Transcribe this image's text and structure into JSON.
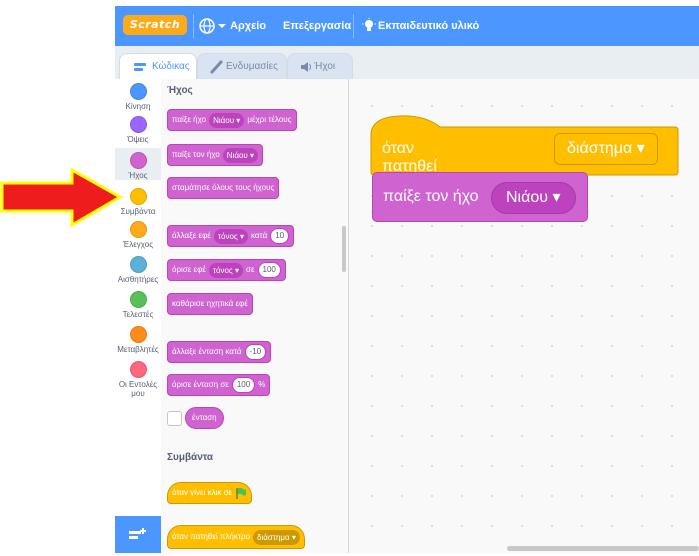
{
  "menubar": {
    "logo": "Scratch",
    "file": "Αρχείο",
    "edit": "Επεξεργασία",
    "tutorials": "Εκπαιδευτικό υλικό"
  },
  "tabs": {
    "code": "Κώδικας",
    "costumes": "Ενδυμασίες",
    "sounds": "Ήχοι"
  },
  "categories": [
    {
      "label": "Κίνηση",
      "color": "#4c97ff"
    },
    {
      "label": "Όψεις",
      "color": "#9966ff"
    },
    {
      "label": "Ήχος",
      "color": "#cf63cf"
    },
    {
      "label": "Συμβάντα",
      "color": "#ffbf00"
    },
    {
      "label": "Έλεγχος",
      "color": "#ffab19"
    },
    {
      "label": "Αισθητήρες",
      "color": "#5cb1d6"
    },
    {
      "label": "Τελεστές",
      "color": "#59c059"
    },
    {
      "label": "Μεταβλητές",
      "color": "#ff8c1a"
    },
    {
      "label": "Οι Εντολές μου",
      "color": "#ff6680"
    }
  ],
  "palette": {
    "sound_header": "Ήχος",
    "play_until_done": {
      "pre": "παίξε ήχο",
      "dd": "Νιάου",
      "post": "μέχρι τέλους"
    },
    "start_sound": {
      "pre": "παίξε τον ήχο",
      "dd": "Νιάου"
    },
    "stop_all": "σταμάτησε όλους τους ήχους",
    "change_effect": {
      "pre": "άλλαξε εφέ",
      "dd": "τόνος",
      "mid": "κατά",
      "val": "10"
    },
    "set_effect": {
      "pre": "όρισε εφέ",
      "dd": "τόνος",
      "mid": "σε",
      "val": "100"
    },
    "clear_effects": "καθάρισε ηχητικά εφέ",
    "change_volume": {
      "pre": "άλλαξε ένταση κατά",
      "val": "-10"
    },
    "set_volume": {
      "pre": "όρισε ένταση σε",
      "val": "100",
      "post": "%"
    },
    "volume_reporter": "ένταση",
    "events_header": "Συμβάντα",
    "when_flag": "όταν γίνει κλικ σε",
    "when_key": {
      "pre": "όταν πατηθεί πλήκτρο",
      "dd": "διάστημα"
    }
  },
  "script": {
    "hat": {
      "pre": "όταν πατηθεί πλήκτρο",
      "dd": "διάστημα"
    },
    "sound": {
      "pre": "παίξε τον ήχο",
      "dd": "Νιάου"
    }
  }
}
